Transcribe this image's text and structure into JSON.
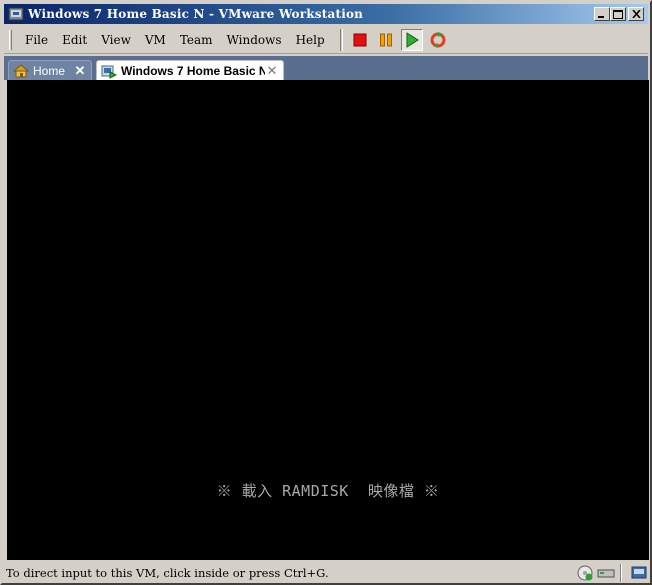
{
  "window": {
    "title": "Windows 7 Home Basic N - VMware Workstation",
    "controls": [
      "minimize",
      "maximize",
      "close"
    ]
  },
  "menu": {
    "items": [
      {
        "label": "File"
      },
      {
        "label": "Edit"
      },
      {
        "label": "View"
      },
      {
        "label": "VM"
      },
      {
        "label": "Team"
      },
      {
        "label": "Windows"
      },
      {
        "label": "Help"
      }
    ]
  },
  "toolbar": {
    "buttons": [
      {
        "icon": "power-off-icon",
        "color": "#e01010"
      },
      {
        "icon": "pause-icon",
        "color": "#f0a000"
      },
      {
        "icon": "play-icon",
        "color": "#20a020",
        "active": true
      },
      {
        "icon": "reset-icon",
        "color": "#e04020"
      }
    ]
  },
  "tabs": [
    {
      "label": "Home",
      "icon": "home-icon",
      "active": false
    },
    {
      "label": "Windows 7 Home Basic N",
      "icon": "vm-icon",
      "active": true
    }
  ],
  "console": {
    "boot_text": "※ 載入 RAMDISK  映像檔 ※",
    "background": "#000000"
  },
  "statusbar": {
    "text": "To direct input to this VM, click inside or press Ctrl+G.",
    "icons": [
      "cd-drive-icon",
      "hard-disk-icon",
      "message-icon"
    ]
  }
}
